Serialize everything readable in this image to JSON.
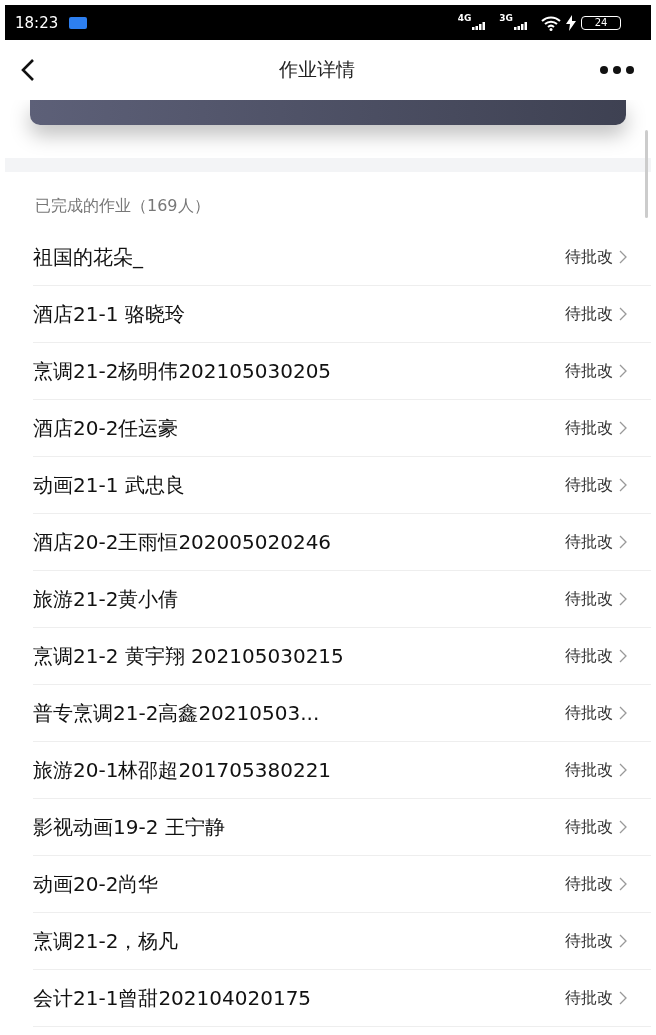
{
  "status_bar": {
    "time": "18:23",
    "network_1": "4G",
    "network_2": "3G",
    "battery": "24"
  },
  "nav": {
    "title": "作业详情"
  },
  "section": {
    "title": "已完成的作业（169人）"
  },
  "rows": [
    {
      "name": "祖国的花朵_",
      "status": "待批改"
    },
    {
      "name": "酒店21-1 骆晓玲",
      "status": "待批改"
    },
    {
      "name": "烹调21-2杨明伟202105030205",
      "status": "待批改"
    },
    {
      "name": "酒店20-2任运豪",
      "status": "待批改"
    },
    {
      "name": "动画21-1 武忠良",
      "status": "待批改"
    },
    {
      "name": "酒店20-2王雨恒202005020246",
      "status": "待批改"
    },
    {
      "name": "旅游21-2黄小倩",
      "status": "待批改"
    },
    {
      "name": "烹调21-2 黄宇翔 202105030215",
      "status": "待批改"
    },
    {
      "name": "普专烹调21-2高鑫20210503...",
      "status": "待批改"
    },
    {
      "name": "旅游20-1林邵超201705380221",
      "status": "待批改"
    },
    {
      "name": "影视动画19-2 王宁静",
      "status": "待批改"
    },
    {
      "name": "动画20-2尚华",
      "status": "待批改"
    },
    {
      "name": "烹调21-2，杨凡",
      "status": "待批改"
    },
    {
      "name": "会计21-1曾甜202104020175",
      "status": "待批改"
    }
  ]
}
